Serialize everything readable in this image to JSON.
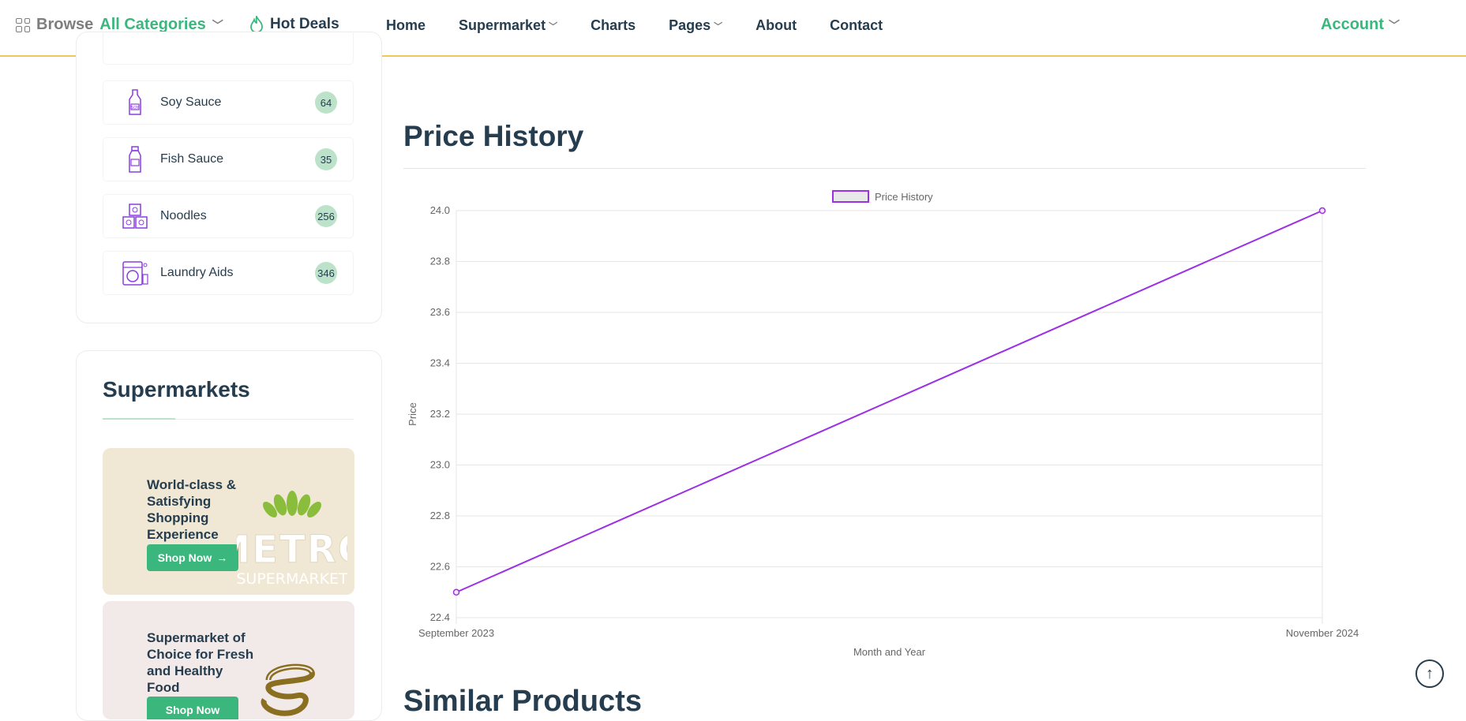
{
  "header": {
    "browse_label": "Browse",
    "categories_label": "All Categories",
    "hot_deals": "Hot Deals",
    "nav": [
      {
        "label": "Home",
        "dropdown": false
      },
      {
        "label": "Supermarket",
        "dropdown": true
      },
      {
        "label": "Charts",
        "dropdown": false
      },
      {
        "label": "Pages",
        "dropdown": true
      },
      {
        "label": "About",
        "dropdown": false
      },
      {
        "label": "Contact",
        "dropdown": false
      }
    ],
    "account": "Account"
  },
  "categories": [
    {
      "name": "Soy Sauce",
      "count": "64",
      "icon": "soy-sauce-bottle-icon"
    },
    {
      "name": "Fish Sauce",
      "count": "35",
      "icon": "fish-sauce-bottle-icon"
    },
    {
      "name": "Noodles",
      "count": "256",
      "icon": "noodles-icon"
    },
    {
      "name": "Laundry Aids",
      "count": "346",
      "icon": "washing-machine-icon"
    }
  ],
  "supermarkets": {
    "title": "Supermarkets",
    "banners": [
      {
        "text": "World-class & Satisfying Shopping Experience",
        "button": "Shop Now",
        "logo_top": "METRO",
        "logo_bottom": "SUPERMARKET"
      },
      {
        "text": "Supermarket of Choice for Fresh and Healthy Food",
        "button": "Shop Now"
      }
    ]
  },
  "price_history": {
    "title": "Price History"
  },
  "chart_data": {
    "type": "line",
    "x": [
      "September 2023",
      "November 2024"
    ],
    "series": [
      {
        "name": "Price History",
        "values": [
          22.5,
          24.0
        ],
        "color": "#9b30e6"
      }
    ],
    "xlabel": "Month and Year",
    "ylabel": "Price",
    "ylim": [
      22.4,
      24.0
    ],
    "yticks": [
      "24.0",
      "23.8",
      "23.6",
      "23.4",
      "23.2",
      "23.0",
      "22.8",
      "22.6",
      "22.4"
    ],
    "grid": true,
    "legend": "top-center"
  },
  "similar_products": {
    "title": "Similar Products"
  },
  "colors": {
    "accent": "#3bb77e",
    "text": "#253d4e",
    "line": "#9b30e6",
    "header_border": "#f1c75a"
  }
}
